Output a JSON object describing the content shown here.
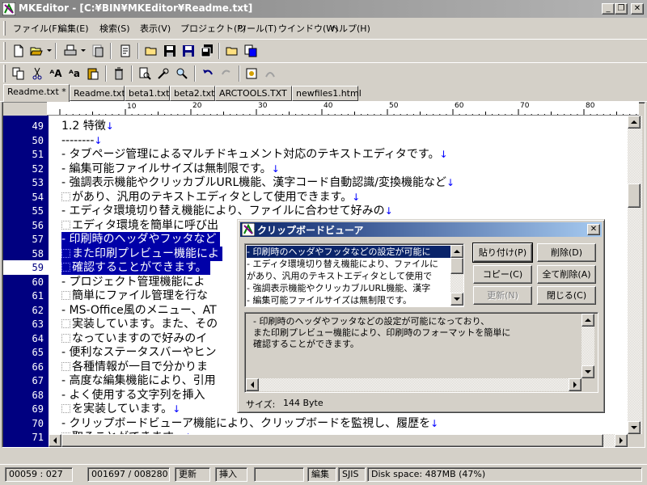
{
  "window": {
    "title": "MKEditor - [C:¥BIN¥MKEditor¥Readme.txt]",
    "minimize": "_",
    "restore": "❐",
    "close": "✕"
  },
  "menu": [
    "ファイル(F)",
    "編集(E)",
    "検索(S)",
    "表示(V)",
    "プロジェクト(P)",
    "ツール(T)",
    "ウインドウ(W)",
    "ヘルプ(H)"
  ],
  "toolbar1": [
    "new-icon",
    "open-icon",
    "print-icon",
    "print-preview-icon",
    "properties-icon",
    "open-folder-icon",
    "save-icon",
    "save-as-icon",
    "save-all-icon",
    "folder-icon",
    "copy-file-icon"
  ],
  "toolbar2": [
    "copy-icon",
    "cut-icon",
    "fullwidth-a-icon",
    "halfwidth-a-icon",
    "paste-icon",
    "trash-icon",
    "find-file-icon",
    "replace-icon",
    "search-icon",
    "undo-icon",
    "redo-disabled-icon",
    "bookmark-icon",
    "settings-icon"
  ],
  "tabs": [
    {
      "label": "Readme.txt *",
      "active": true
    },
    {
      "label": "Readme.txt",
      "active": false
    },
    {
      "label": "beta1.txt",
      "active": false
    },
    {
      "label": "beta2.txt",
      "active": false
    },
    {
      "label": "ARCTOOLS.TXT",
      "active": false
    },
    {
      "label": "newfiles1.html",
      "active": false
    }
  ],
  "ruler": {
    "marks": [
      "10",
      "20",
      "30",
      "40",
      "50",
      "60",
      "70",
      "80",
      "90"
    ]
  },
  "editor": {
    "current_line": "59",
    "lines": [
      {
        "num": "49",
        "text": "1.2 特徴",
        "eol": "↓"
      },
      {
        "num": "50",
        "text": "--------",
        "eol": "↓"
      },
      {
        "num": "51",
        "text": "- タブページ管理によるマルチドキュメント対応のテキストエディタです。",
        "eol": "↓"
      },
      {
        "num": "52",
        "text": "- 編集可能ファイルサイズは無制限です。",
        "eol": "↓"
      },
      {
        "num": "53",
        "text": "- 強調表示機能やクリッカブルURL機能、漢字コード自動認識/変換機能など",
        "eol": "↓"
      },
      {
        "num": "54",
        "text": "があり、汎用のテキストエディタとして使用できます。",
        "eol": "↓",
        "tab": true
      },
      {
        "num": "55",
        "text": "- エディタ環境切り替え機能により、ファイルに合わせて好みの",
        "eol": "↓"
      },
      {
        "num": "56",
        "text": "エディタ環境を簡単に呼び出",
        "eol": "",
        "tab": true
      },
      {
        "num": "57",
        "text": "- 印刷時のヘッダやフッタなど",
        "eol": "",
        "sel": true
      },
      {
        "num": "58",
        "text": "また印刷プレビュー機能によ",
        "eol": "",
        "sel": true,
        "tab": true
      },
      {
        "num": "59",
        "text": "確認することができます。",
        "eol": "",
        "sel": true,
        "tab": true
      },
      {
        "num": "60",
        "text": "- プロジェクト管理機能によ",
        "eol": ""
      },
      {
        "num": "61",
        "text": "簡単にファイル管理を行な",
        "eol": "",
        "tab": true
      },
      {
        "num": "62",
        "text": "- MS-Office風のメニュー、AT",
        "eol": ""
      },
      {
        "num": "63",
        "text": "実装しています。また、その",
        "eol": "",
        "tab": true
      },
      {
        "num": "64",
        "text": "なっていますので好みのイ",
        "eol": "",
        "tab": true
      },
      {
        "num": "65",
        "text": "- 便利なステータスバーやヒン",
        "eol": ""
      },
      {
        "num": "66",
        "text": "各種情報が一目で分かりま",
        "eol": "",
        "tab": true
      },
      {
        "num": "67",
        "text": "- 高度な編集機能により、引用",
        "eol": ""
      },
      {
        "num": "68",
        "text": "- よく使用する文字列を挿入",
        "eol": ""
      },
      {
        "num": "69",
        "text": "を実装しています。",
        "eol": "↓",
        "tab": true
      },
      {
        "num": "70",
        "text": "- クリップボードビューア機能により、クリップボードを監視し、履歴を",
        "eol": "↓"
      },
      {
        "num": "71",
        "text": "取ることができます。",
        "eol": "↓",
        "tab": true
      },
      {
        "num": "72",
        "text": "",
        "eol": ""
      }
    ]
  },
  "clipboard_viewer": {
    "title": "クリップボードビューア",
    "items": [
      "- 印刷時のヘッダやフッタなどの設定が可能に",
      "- エディタ環境切り替え機能により、ファイルに",
      "があり、汎用のテキストエディタとして使用で",
      "- 強調表示機能やクリッカブルURL機能、漢字",
      "- 編集可能ファイルサイズは無制限です。"
    ],
    "buttons": {
      "paste": "貼り付け(P)",
      "delete": "削除(D)",
      "copy": "コピー(C)",
      "delete_all": "全て削除(A)",
      "update": "更新(N)",
      "close": "閉じる(C)"
    },
    "preview_lines": [
      "- 印刷時のヘッダやフッタなどの設定が可能になっており、",
      "また印刷プレビュー機能により、印刷時のフォーマットを簡単に",
      "確認することができます。"
    ],
    "size_label": "サイズ:",
    "size_value": "144 Byte"
  },
  "status": {
    "position": "00059 : 027",
    "chars": "001697 / 008280",
    "state": "更新",
    "mode": "挿入",
    "edit": "編集",
    "encoding": "SJIS",
    "disk": "Disk space: 487MB (47%)"
  }
}
